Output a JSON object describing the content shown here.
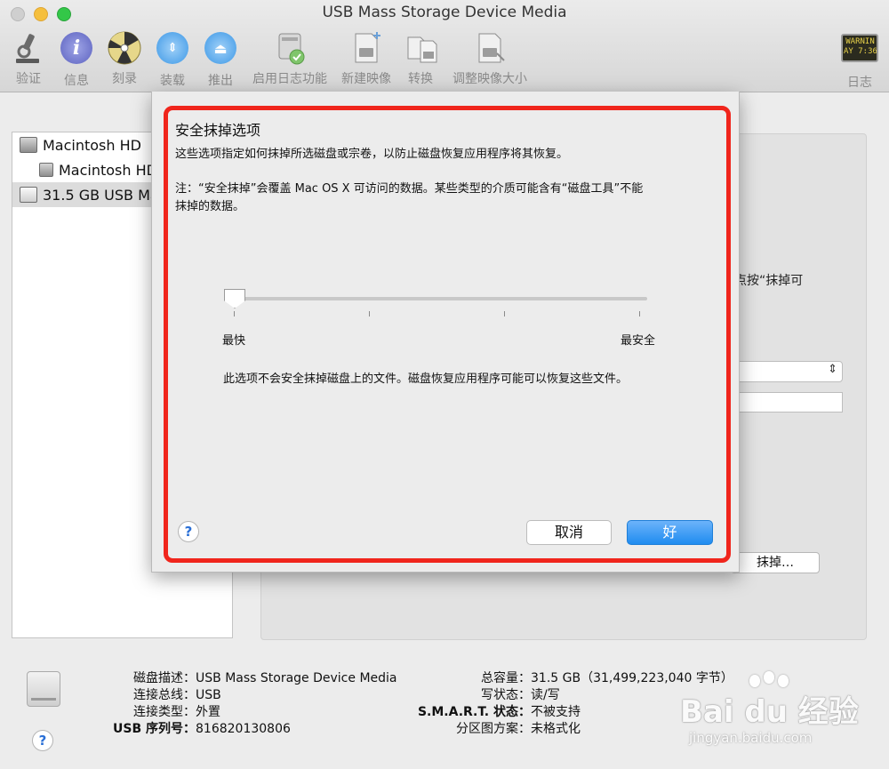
{
  "window": {
    "title": "USB Mass Storage Device Media"
  },
  "toolbar": {
    "items": [
      {
        "label": "验证",
        "icon": "microscope-icon"
      },
      {
        "label": "信息",
        "icon": "info-icon"
      },
      {
        "label": "刻录",
        "icon": "burn-icon"
      },
      {
        "label": "装载",
        "icon": "mount-icon"
      },
      {
        "label": "推出",
        "icon": "eject-icon"
      },
      {
        "label": "启用日志功能",
        "icon": "enable-journaling-icon"
      },
      {
        "label": "新建映像",
        "icon": "new-image-icon"
      },
      {
        "label": "转换",
        "icon": "convert-icon"
      },
      {
        "label": "调整映像大小",
        "icon": "resize-image-icon"
      }
    ],
    "log": {
      "label": "日志",
      "screen_text_1": "WARNIN",
      "screen_text_2": "AY 7:36"
    }
  },
  "sidebar": {
    "items": [
      {
        "label": "Macintosh HD"
      },
      {
        "label": "Macintosh HD"
      },
      {
        "label": "31.5 GB USB Ma"
      }
    ]
  },
  "background": {
    "text_fragment": "点按“抹掉可",
    "erase_button": "抹掉…"
  },
  "sheet": {
    "title": "安全抹掉选项",
    "description": "这些选项指定如何抹掉所选磁盘或宗卷，以防止磁盘恢复应用程序将其恢复。",
    "note_line1": "注：“安全抹掉”会覆盖 Mac OS X 可访问的数据。某些类型的介质可能含有“磁盘工具”不能",
    "note_line2": "抹掉的数据。",
    "slider": {
      "min_label": "最快",
      "max_label": "最安全",
      "value_fraction": 0
    },
    "slider_description": "此选项不会安全抹掉磁盘上的文件。磁盘恢复应用程序可能可以恢复这些文件。",
    "cancel": "取消",
    "ok": "好",
    "help": "?"
  },
  "info": {
    "left": [
      {
        "key": "磁盘描述：",
        "value": "USB Mass Storage Device Media"
      },
      {
        "key": "连接总线：",
        "value": "USB"
      },
      {
        "key": "连接类型：",
        "value": "外置"
      },
      {
        "key": "USB 序列号：",
        "value": "816820130806"
      }
    ],
    "right": [
      {
        "key": "总容量：",
        "value": "31.5 GB（31,499,223,040 字节）"
      },
      {
        "key": "写状态：",
        "value": "读/写"
      },
      {
        "key": "S.M.A.R.T. 状态：",
        "value": "不被支持"
      },
      {
        "key": "分区图方案：",
        "value": "未格式化"
      }
    ],
    "help": "?"
  },
  "watermark": {
    "main": "Bai du 经验",
    "sub": "jingyan.baidu.com"
  },
  "colors": {
    "highlight": "#f0251c",
    "ok_button": "#1f8cf0"
  }
}
